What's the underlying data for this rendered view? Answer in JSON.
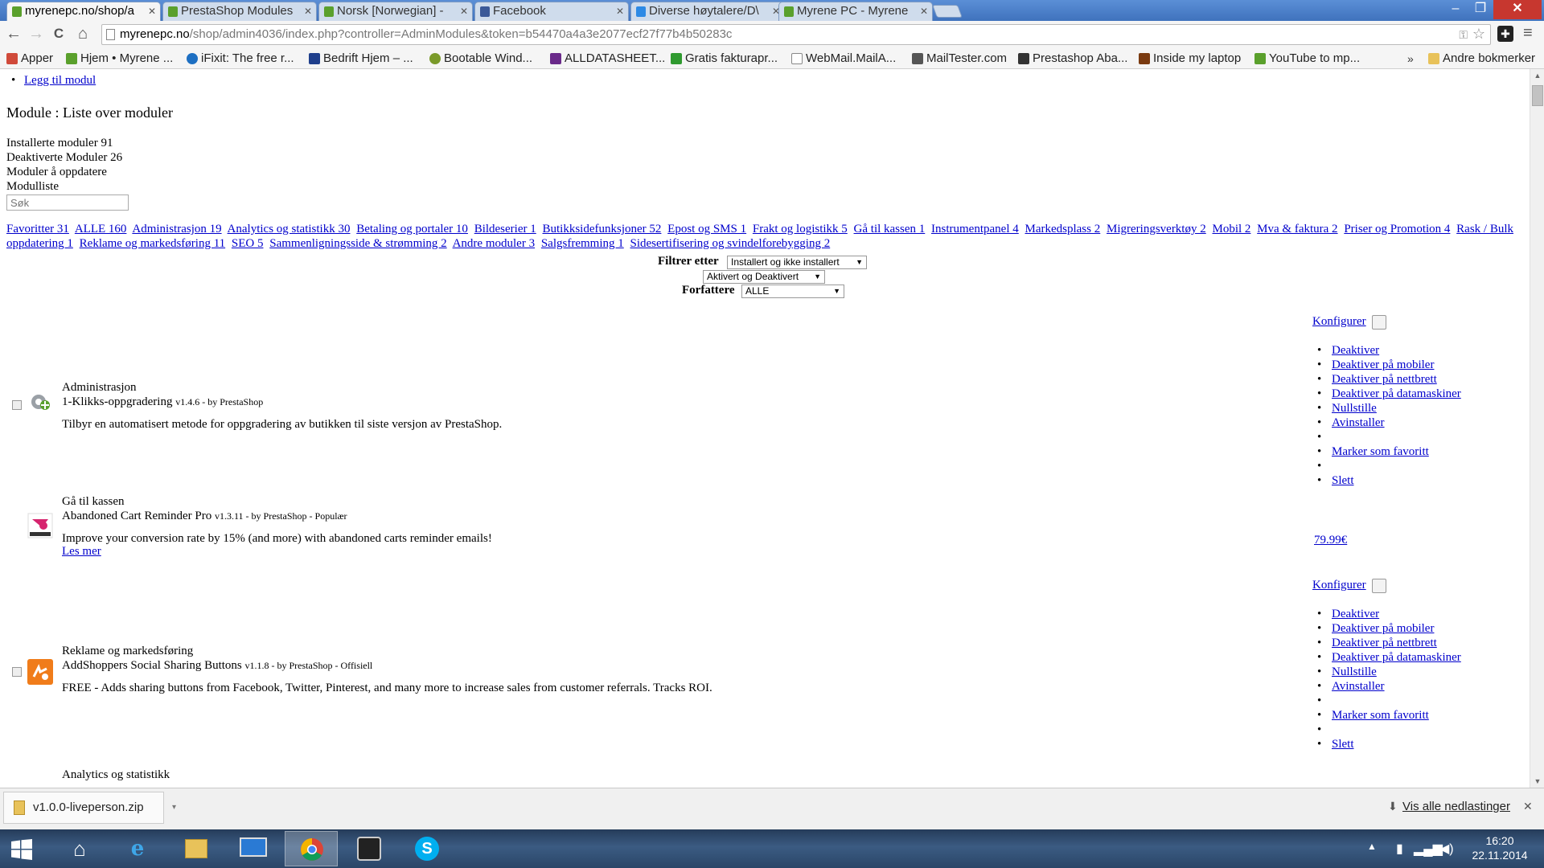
{
  "browser": {
    "tabs": [
      {
        "title": "myrenepc.no/shop/a",
        "color": "#5aa02c",
        "active": true
      },
      {
        "title": "PrestaShop Modules",
        "color": "#5aa02c",
        "active": false
      },
      {
        "title": "Norsk [Norwegian] -",
        "color": "#5aa02c",
        "active": false
      },
      {
        "title": "Facebook",
        "color": "#3b5998",
        "active": false
      },
      {
        "title": "Diverse høytalere/D\\",
        "color": "#2d8ae5",
        "active": false
      },
      {
        "title": "Myrene PC - Myrene",
        "color": "#5aa02c",
        "active": false
      }
    ],
    "window_controls": {
      "minimize": "–",
      "maximize": "❐",
      "close": "✕"
    },
    "nav": {
      "back": "←",
      "forward": "→",
      "reload": "C",
      "home": "⌂"
    },
    "address": {
      "host": "myrenepc.no",
      "path": "/shop/admin4036/index.php?controller=AdminModules&token=b54470a4a3e2077ecf27f77b4b50283c"
    },
    "bookmarks": [
      {
        "label": "Apper",
        "color": "#d04a3a"
      },
      {
        "label": "Hjem • Myrene ...",
        "color": "#5aa02c"
      },
      {
        "label": "iFixit: The free r...",
        "color": "#1d6fc2"
      },
      {
        "label": "Bedrift Hjem – ...",
        "color": "#1f3f8c"
      },
      {
        "label": "Bootable Wind...",
        "color": "#7a9a2a"
      },
      {
        "label": "ALLDATASHEET...",
        "color": "#6a2a8a"
      },
      {
        "label": "Gratis fakturapr...",
        "color": "#2f9a2f"
      },
      {
        "label": "WebMail.MailA...",
        "color": "#ffffff"
      },
      {
        "label": "MailTester.com",
        "color": "#555555"
      },
      {
        "label": "Prestashop Aba...",
        "color": "#333333"
      },
      {
        "label": "Inside my laptop",
        "color": "#7a3a10"
      },
      {
        "label": "YouTube to mp...",
        "color": "#5aa02c"
      }
    ],
    "bookmarks_more": "»",
    "bookmarks_other": "Andre bokmerker"
  },
  "page": {
    "add_module": "Legg til modul",
    "heading": "Module : Liste over moduler",
    "stats": {
      "installed": "Installerte moduler 91",
      "deactivated": "Deaktiverte Moduler 26",
      "to_update": "Moduler å oppdatere",
      "module_list": "Modulliste"
    },
    "search_placeholder": "Søk",
    "categories": [
      "Favoritter 31",
      "ALLE 160",
      "Administrasjon 19",
      "Analytics og statistikk 30",
      "Betaling og portaler 10",
      "Bildeserier 1",
      "Butikksidefunksjoner 52",
      "Epost og SMS 1",
      "Frakt og logistikk 5",
      "Gå til kassen 1",
      "Instrumentpanel 4",
      "Markedsplass 2",
      "Migreringsverktøy 2",
      "Mobil 2",
      "Mva & faktura 2",
      "Priser og Promotion 4",
      "Rask / Bulk oppdatering 1",
      "Reklame og markedsføring 11",
      "SEO 5",
      "Sammenligningsside & strømming 2",
      "Andre moduler 3",
      "Salgsfremming 1",
      "Sidesertifisering og svindelforebygging 2"
    ],
    "filters": {
      "filter_label": "Filtrer etter",
      "install_value": "Installert og ikke installert",
      "status_value": "Aktivert og Deaktivert",
      "authors_label": "Forfattere",
      "authors_value": "ALLE"
    },
    "modules": [
      {
        "category": "Administrasjon",
        "name": "1-Klikks-oppgradering",
        "version": "v1.4.6 - by PrestaShop",
        "description": "Tilbyr en automatisert metode for oppgradering av butikken til siste versjon av PrestaShop.",
        "icon": "gear-icon"
      },
      {
        "category": "Gå til kassen",
        "name": "Abandoned Cart Reminder Pro",
        "version": "v1.3.11 - by PrestaShop - Populær",
        "description": "Improve your conversion rate by 15% (and more) with abandoned carts reminder emails!",
        "more": "Les mer",
        "price": "79.99€",
        "icon": "cart-reminder-icon"
      },
      {
        "category": "Reklame og markedsføring",
        "name": "AddShoppers Social Sharing Buttons",
        "version": "v1.1.8 - by PrestaShop - Offisiell",
        "description": "FREE - Adds sharing buttons from Facebook, Twitter, Pinterest, and many more to increase sales from customer referrals. Tracks ROI.",
        "icon": "addshoppers-icon"
      },
      {
        "category": "Analytics og statistikk"
      }
    ],
    "actions": {
      "configure": "Konfigurer",
      "items": [
        "Deaktiver",
        "Deaktiver på mobiler",
        "Deaktiver på nettbrett",
        "Deaktiver på datamaskiner",
        "Nullstille",
        "Avinstaller",
        "",
        "Marker som favoritt",
        "",
        "Slett"
      ]
    }
  },
  "downloads": {
    "file": "v1.0.0-liveperson.zip",
    "show_all": "Vis alle nedlastinger",
    "close": "✕"
  },
  "taskbar": {
    "time": "16:20",
    "date": "22.11.2014"
  }
}
